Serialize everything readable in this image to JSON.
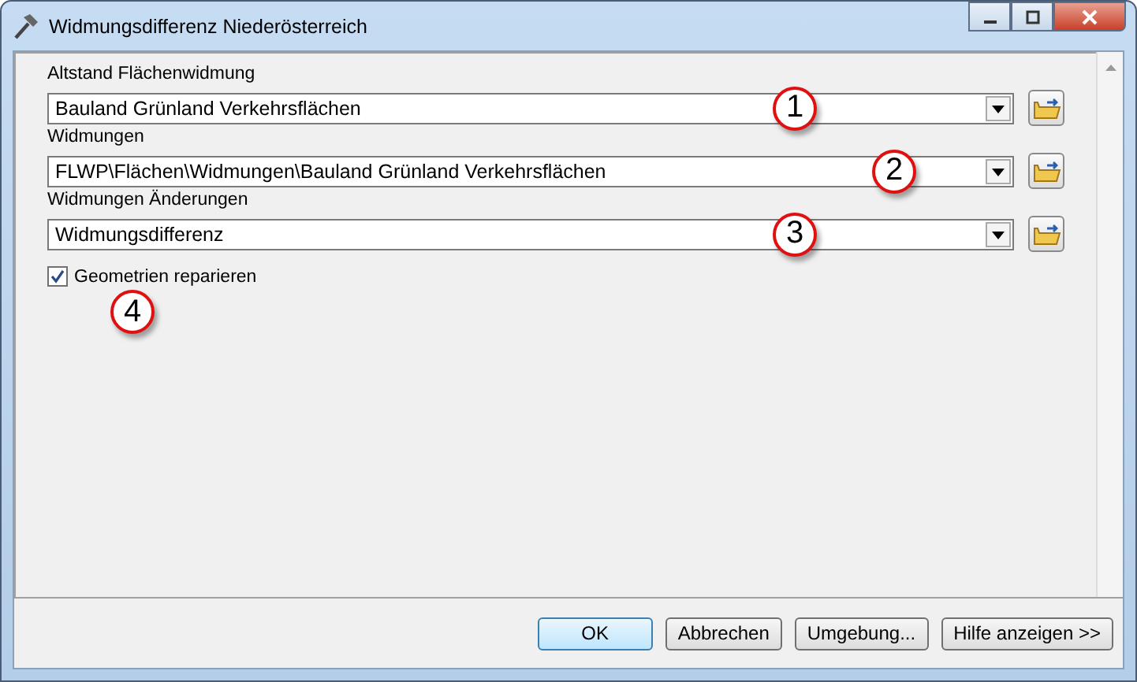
{
  "window": {
    "title": "Widmungsdifferenz Niederösterreich"
  },
  "fields": [
    {
      "label": "Altstand Flächenwidmung",
      "value": "Bauland Grünland Verkehrsflächen",
      "callout": "1"
    },
    {
      "label": "Widmungen",
      "value": "FLWP\\Flächen\\Widmungen\\Bauland Grünland Verkehrsflächen",
      "callout": "2"
    },
    {
      "label": "Widmungen Änderungen",
      "value": "Widmungsdifferenz",
      "callout": "3"
    }
  ],
  "checkbox": {
    "label": "Geometrien reparieren",
    "checked": true,
    "callout": "4"
  },
  "buttons": [
    {
      "label": "OK",
      "default": true
    },
    {
      "label": "Abbrechen",
      "default": false
    },
    {
      "label": "Umgebung...",
      "default": false
    },
    {
      "label": "Hilfe anzeigen >>",
      "default": false
    }
  ]
}
